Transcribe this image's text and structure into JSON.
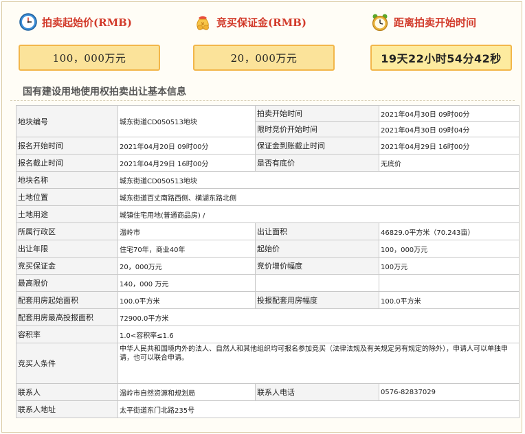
{
  "summary": {
    "start_price": {
      "label": "拍卖起始价(RMB)",
      "value": "100，000万元",
      "icon": "clock-icon"
    },
    "deposit": {
      "label": "竞买保证金(RMB)",
      "value": "20，000万元",
      "icon": "money-bag-icon"
    },
    "countdown": {
      "label": "距离拍卖开始时间",
      "value": "19天22小时54分42秒",
      "icon": "alarm-clock-icon"
    }
  },
  "section_title": "国有建设用地使用权拍卖出让基本信息",
  "table": {
    "plot_no_label": "地块编号",
    "plot_no": "城东街道CD050513地块",
    "auction_start_label": "拍卖开始时间",
    "auction_start": "2021年04月30日 09时00分",
    "limit_bid_start_label": "限时竞价开始时间",
    "limit_bid_start": "2021年04月30日 09时04分",
    "reg_start_label": "报名开始时间",
    "reg_start": "2021年04月20日 09时00分",
    "deposit_deadline_label": "保证金到账截止时间",
    "deposit_deadline": "2021年04月29日 16时00分",
    "reg_end_label": "报名截止时间",
    "reg_end": "2021年04月29日 16时00分",
    "reserve_label": "是否有底价",
    "reserve": "无底价",
    "plot_name_label": "地块名称",
    "plot_name": "城东街道CD050513地块",
    "location_label": "土地位置",
    "location": "城东街道百丈南路西侧、横湖东路北侧",
    "usage_label": "土地用途",
    "usage": "城镇住宅用地(普通商品房) /",
    "district_label": "所属行政区",
    "district": "温岭市",
    "area_label": "出让面积",
    "area": "46829.0平方米（70.243亩）",
    "term_label": "出让年限",
    "term": "住宅70年，商业40年",
    "start_price_label": "起始价",
    "start_price": "100，000万元",
    "deposit_label": "竞买保证金",
    "deposit": "20，000万元",
    "increment_label": "竞价增价幅度",
    "increment": "100万元",
    "max_price_label": "最高限价",
    "max_price": "140，000 万元",
    "housing_start_label": "配套用房起始面积",
    "housing_start": "100.0平方米",
    "housing_step_label": "投报配套用房幅度",
    "housing_step": "100.0平方米",
    "housing_max_label": "配套用房最高投报面积",
    "housing_max": "72900.0平方米",
    "far_label": "容积率",
    "far": "1.0<容积率≤1.6",
    "bidder_label": "竞买人条件",
    "bidder": "中华人民共和国境内外的法人、自然人和其他组织均可报名参加竞买（法律法规及有关规定另有规定的除外），申请人可以单独申请，也可以联合申请。",
    "contact_label": "联系人",
    "contact": "温岭市自然资源和规划局",
    "phone_label": "联系人电话",
    "phone": "0576-82837029",
    "address_label": "联系人地址",
    "address": "太平街道东门北路235号"
  }
}
